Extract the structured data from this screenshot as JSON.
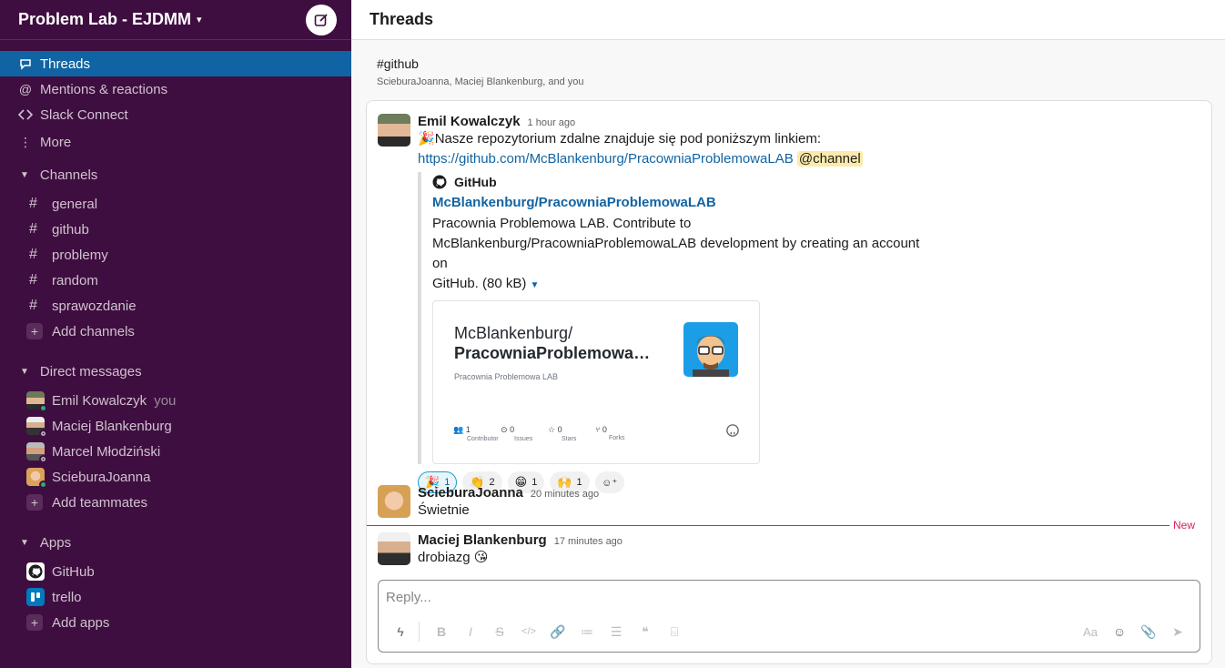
{
  "workspace": {
    "name": "Problem Lab - EJDMM"
  },
  "nav": [
    {
      "label": "Threads",
      "icon": "threads-icon",
      "active": true
    },
    {
      "label": "Mentions & reactions",
      "icon": "at-icon"
    },
    {
      "label": "Slack Connect",
      "icon": "slack-connect-icon"
    },
    {
      "label": "More",
      "icon": "more-vertical-icon"
    }
  ],
  "channels": {
    "heading": "Channels",
    "items": [
      "general",
      "github",
      "problemy",
      "random",
      "sprawozdanie"
    ],
    "add_label": "Add channels"
  },
  "direct_messages": {
    "heading": "Direct messages",
    "items": [
      {
        "name": "Emil Kowalczyk",
        "suffix": "you",
        "status": "online"
      },
      {
        "name": "Maciej Blankenburg",
        "status": "away"
      },
      {
        "name": "Marcel Młodziński",
        "status": "away"
      },
      {
        "name": "ScieburaJoanna",
        "status": "online"
      }
    ],
    "add_label": "Add teammates"
  },
  "apps": {
    "heading": "Apps",
    "items": [
      "GitHub",
      "trello"
    ],
    "add_label": "Add apps"
  },
  "main": {
    "title": "Threads",
    "thread_channel": "#github",
    "thread_people": "ScieburaJoanna, Maciej Blankenburg, and you"
  },
  "messages": [
    {
      "author": "Emil Kowalczyk",
      "time": "1 hour ago",
      "text_emoji": "🎉",
      "text": "Nasze repozytorium zdalne znajduje się pod poniższym linkiem:",
      "link": "https://github.com/McBlankenburg/PracowniaProblemowaLAB",
      "mention": "@channel",
      "unfurl": {
        "source": "GitHub",
        "title": "McBlankenburg/PracowniaProblemowaLAB",
        "desc_line1": "Pracownia Problemowa LAB. Contribute to",
        "desc_line2": "McBlankenburg/PracowniaProblemowaLAB development by creating an account on",
        "desc_line3": "GitHub. (80 kB)",
        "preview": {
          "owner": "McBlankenburg/",
          "repo": "PracowniaProblemowaLAB",
          "subtitle": "Pracownia Problemowa LAB",
          "stats": [
            {
              "count": "1",
              "label": "Contributor",
              "icon": "people-icon"
            },
            {
              "count": "0",
              "label": "Issues",
              "icon": "issue-icon"
            },
            {
              "count": "0",
              "label": "Stars",
              "icon": "star-icon"
            },
            {
              "count": "0",
              "label": "Forks",
              "icon": "fork-icon"
            }
          ]
        }
      },
      "reactions": [
        {
          "emoji": "🎉",
          "count": "1",
          "mine": true
        },
        {
          "emoji": "👏",
          "count": "2"
        },
        {
          "emoji": "😁",
          "count": "1"
        },
        {
          "emoji": "🙌",
          "count": "1"
        }
      ]
    },
    {
      "author": "ScieburaJoanna",
      "time": "20 minutes ago",
      "text": "Świetnie"
    },
    {
      "author": "Maciej Blankenburg",
      "time": "17 minutes ago",
      "text": "drobiazg",
      "text_emoji": "😘"
    }
  ],
  "new_divider": "New",
  "composer": {
    "placeholder": "Reply...",
    "font_toggle": "Aa"
  },
  "colors": {
    "sidebar_bg": "#3f0e40",
    "active_blue": "#1164a3",
    "link": "#1264a3",
    "new_divider": "#e01e5a",
    "online": "#2bac76"
  }
}
